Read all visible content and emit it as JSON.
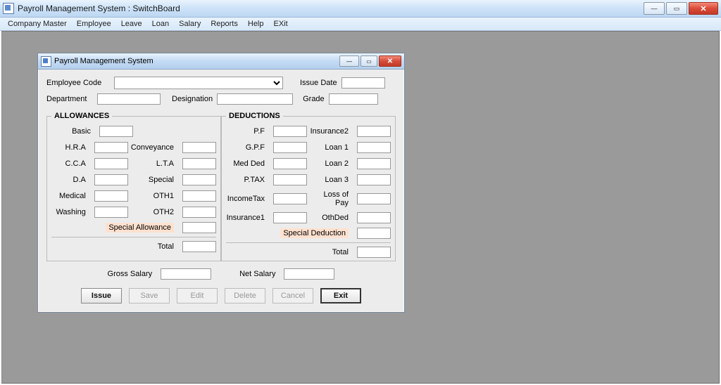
{
  "app": {
    "title": "Payroll Management System : SwitchBoard",
    "menus": [
      "Company Master",
      "Employee",
      "Leave",
      "Loan",
      "Salary",
      "Reports",
      "Help",
      "EXit"
    ]
  },
  "child": {
    "title": "Payroll Management System"
  },
  "header": {
    "emp_code_label": "Employee Code",
    "issue_date_label": "Issue Date",
    "dept_label": "Department",
    "desig_label": "Designation",
    "grade_label": "Grade",
    "emp_code": "",
    "issue_date": "",
    "dept": "",
    "desig": "",
    "grade": ""
  },
  "allowances": {
    "legend": "ALLOWANCES",
    "labels": {
      "basic": "Basic",
      "hra": "H.R.A",
      "cca": "C.C.A",
      "da": "D.A",
      "medical": "Medical",
      "washing": "Washing",
      "conveyance": "Conveyance",
      "lta": "L.T.A",
      "special": "Special",
      "oth1": "OTH1",
      "oth2": "OTH2",
      "special_allowance": "Special Allowance",
      "total": "Total"
    },
    "values": {
      "basic": "",
      "hra": "",
      "cca": "",
      "da": "",
      "medical": "",
      "washing": "",
      "conveyance": "",
      "lta": "",
      "special": "",
      "oth1": "",
      "oth2": "",
      "special_allowance": "",
      "total": ""
    }
  },
  "deductions": {
    "legend": "DEDUCTIONS",
    "labels": {
      "pf": "P.F",
      "gpf": "G.P.F",
      "medded": "Med Ded",
      "ptax": "P.TAX",
      "inctax": "IncomeTax",
      "ins1": "Insurance1",
      "ins2": "Insurance2",
      "loan1": "Loan 1",
      "loan2": "Loan 2",
      "loan3": "Loan 3",
      "lop": "Loss of Pay",
      "othded": "OthDed",
      "special_deduction": "Special Deduction",
      "total": "Total"
    },
    "values": {
      "pf": "",
      "gpf": "",
      "medded": "",
      "ptax": "",
      "inctax": "",
      "ins1": "",
      "ins2": "",
      "loan1": "",
      "loan2": "",
      "loan3": "",
      "lop": "",
      "othded": "",
      "special_deduction": "",
      "total": ""
    }
  },
  "salary": {
    "gross_label": "Gross Salary",
    "net_label": "Net Salary",
    "gross": "",
    "net": ""
  },
  "buttons": {
    "issue": "Issue",
    "save": "Save",
    "edit": "Edit",
    "delete": "Delete",
    "cancel": "Cancel",
    "exit": "Exit"
  }
}
